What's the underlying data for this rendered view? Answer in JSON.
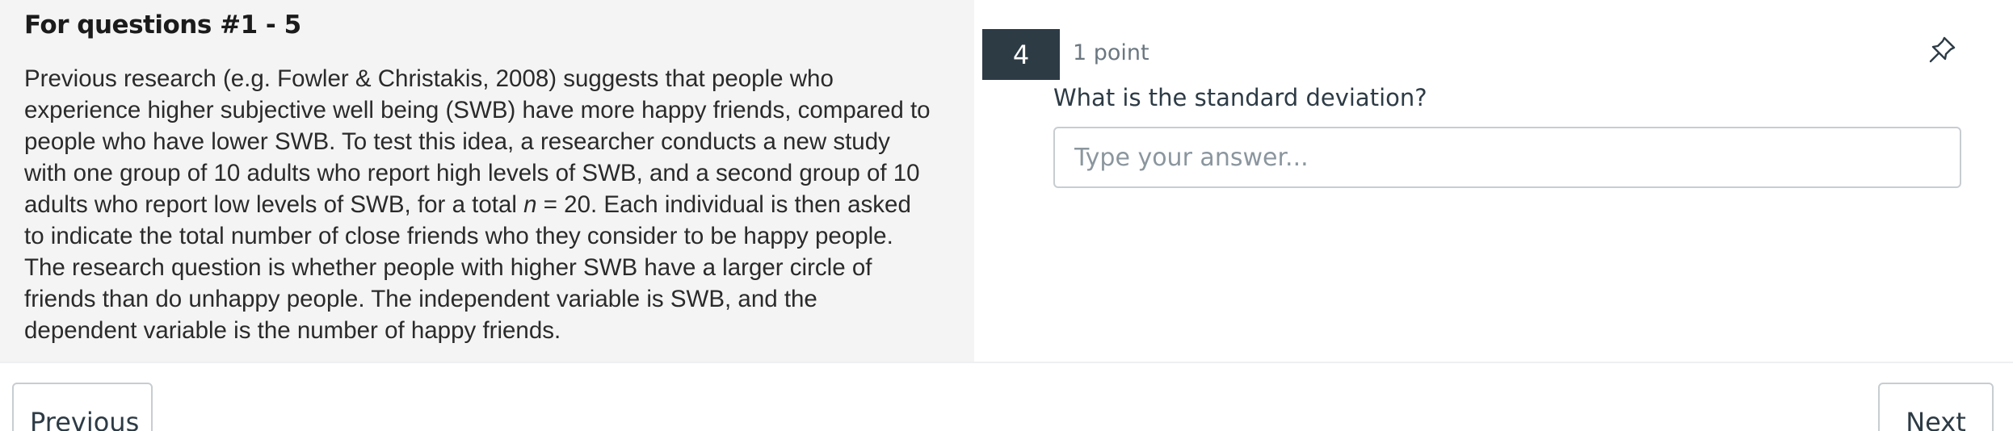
{
  "passage": {
    "title": "For questions #1 - 5",
    "lines": [
      "Previous research (e.g. Fowler & Christakis, 2008) suggests that people who",
      "experience higher subjective well being (SWB) have more happy friends, compared to",
      "people who have lower SWB.  To test this idea, a researcher conducts a new study",
      "with one group of 10 adults who report high levels of SWB, and a second group of 10",
      "to indicate the total number of close friends who they consider to be happy people.",
      "The research question is whether people with higher SWB have a larger circle of",
      "friends than do unhappy people.  The independent variable is SWB, and the",
      "dependent variable is the number of happy friends."
    ],
    "line5_pre": "adults who report low levels of SWB, for a total ",
    "line5_italic": "n",
    "line5_post": " = 20.  Each individual is then asked"
  },
  "question": {
    "number": "4",
    "points": "1 point",
    "pin_icon": "pin-icon",
    "text": "What is the standard deviation?",
    "answer_value": "",
    "answer_placeholder": "Type your answer..."
  },
  "navigation": {
    "previous_label": "Previous",
    "next_label": "Next"
  }
}
